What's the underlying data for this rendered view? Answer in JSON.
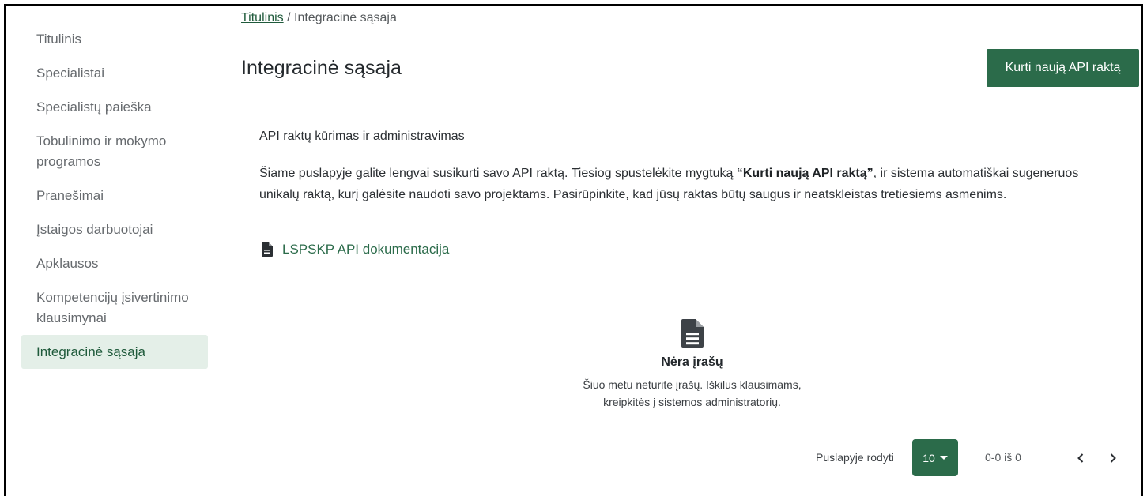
{
  "sidebar": {
    "items": [
      {
        "label": "Titulinis"
      },
      {
        "label": "Specialistai"
      },
      {
        "label": "Specialistų paieška"
      },
      {
        "label": "Tobulinimo ir mokymo programos"
      },
      {
        "label": "Pranešimai"
      },
      {
        "label": "Įstaigos darbuotojai"
      },
      {
        "label": "Apklausos"
      },
      {
        "label": "Kompetencijų įsivertinimo klausimynai"
      },
      {
        "label": "Integracinė sąsaja"
      }
    ],
    "active_item": "Integracinė sąsaja"
  },
  "breadcrumb": {
    "home": "Titulinis",
    "separator": "/",
    "current": "Integracinė sąsaja"
  },
  "page": {
    "title": "Integracinė sąsaja",
    "create_button_label": "Kurti naują API raktą",
    "section_title": "API raktų kūrimas ir administravimas",
    "description_before": "Šiame puslapyje galite lengvai susikurti savo API raktą. Tiesiog spustelėkite mygtuką ",
    "description_bold": "“Kurti naują API raktą”",
    "description_after": ", ir sistema automatiškai sugeneruos unikalų raktą, kurį galėsite naudoti savo projektams. Pasirūpinkite, kad jūsų raktas būtų saugus ir neatskleistas tretiesiems asmenims.",
    "doc_link": {
      "label": "LSPSKP API dokumentacija",
      "icon": "file-text-icon"
    }
  },
  "empty_state": {
    "icon": "file-text-icon",
    "title": "Nėra įrašų",
    "text_line1": "Šiuo metu neturite įrašų. Iškilus klausimams,",
    "text_line2": "kreipkitės į sistemos administratorių."
  },
  "pagination": {
    "rows_label": "Puslapyje rodyti",
    "page_size": "10",
    "range": "0-0 iš 0",
    "prev_icon": "chevron-left-icon",
    "next_icon": "chevron-right-icon"
  },
  "colors": {
    "accent": "#2b6b4a",
    "active_bg": "#e4efe8"
  }
}
